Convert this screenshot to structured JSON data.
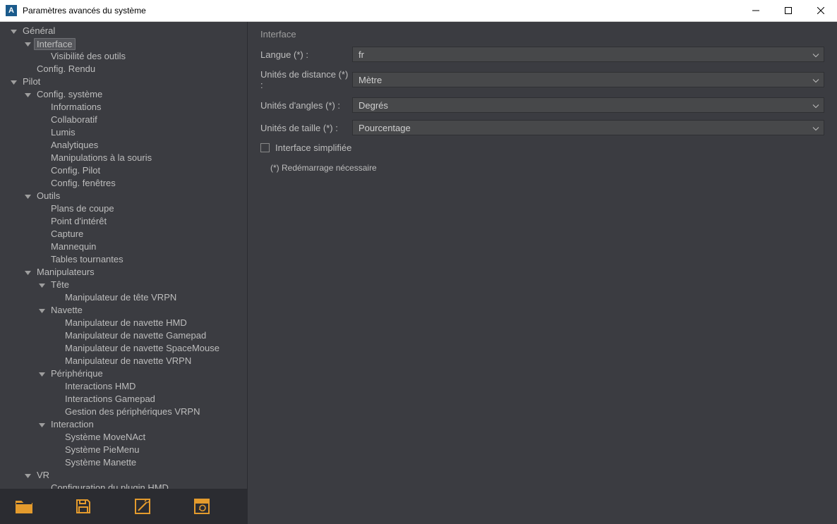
{
  "window": {
    "title": "Paramètres avancés du système",
    "icon_letter": "A"
  },
  "tree": [
    {
      "depth": 0,
      "exp": true,
      "label": "Général"
    },
    {
      "depth": 1,
      "exp": true,
      "label": "Interface",
      "selected": true
    },
    {
      "depth": 2,
      "exp": null,
      "label": "Visibilité des outils"
    },
    {
      "depth": 1,
      "exp": null,
      "label": "Config. Rendu"
    },
    {
      "depth": 0,
      "exp": true,
      "label": "Pilot"
    },
    {
      "depth": 1,
      "exp": true,
      "label": "Config. système"
    },
    {
      "depth": 2,
      "exp": null,
      "label": "Informations"
    },
    {
      "depth": 2,
      "exp": null,
      "label": "Collaboratif"
    },
    {
      "depth": 2,
      "exp": null,
      "label": "Lumis"
    },
    {
      "depth": 2,
      "exp": null,
      "label": "Analytiques"
    },
    {
      "depth": 2,
      "exp": null,
      "label": "Manipulations à la souris"
    },
    {
      "depth": 2,
      "exp": null,
      "label": "Config. Pilot"
    },
    {
      "depth": 2,
      "exp": null,
      "label": "Config. fenêtres"
    },
    {
      "depth": 1,
      "exp": true,
      "label": "Outils"
    },
    {
      "depth": 2,
      "exp": null,
      "label": "Plans de coupe"
    },
    {
      "depth": 2,
      "exp": null,
      "label": "Point d'intérêt"
    },
    {
      "depth": 2,
      "exp": null,
      "label": "Capture"
    },
    {
      "depth": 2,
      "exp": null,
      "label": "Mannequin"
    },
    {
      "depth": 2,
      "exp": null,
      "label": "Tables tournantes"
    },
    {
      "depth": 1,
      "exp": true,
      "label": "Manipulateurs"
    },
    {
      "depth": 2,
      "exp": true,
      "label": "Tête"
    },
    {
      "depth": 3,
      "exp": null,
      "label": "Manipulateur de tête VRPN"
    },
    {
      "depth": 2,
      "exp": true,
      "label": "Navette"
    },
    {
      "depth": 3,
      "exp": null,
      "label": "Manipulateur de navette HMD"
    },
    {
      "depth": 3,
      "exp": null,
      "label": "Manipulateur de navette Gamepad"
    },
    {
      "depth": 3,
      "exp": null,
      "label": "Manipulateur de navette SpaceMouse"
    },
    {
      "depth": 3,
      "exp": null,
      "label": "Manipulateur de navette VRPN"
    },
    {
      "depth": 2,
      "exp": true,
      "label": "Périphérique"
    },
    {
      "depth": 3,
      "exp": null,
      "label": "Interactions HMD"
    },
    {
      "depth": 3,
      "exp": null,
      "label": "Interactions Gamepad"
    },
    {
      "depth": 3,
      "exp": null,
      "label": "Gestion des périphériques VRPN"
    },
    {
      "depth": 2,
      "exp": true,
      "label": "Interaction"
    },
    {
      "depth": 3,
      "exp": null,
      "label": "Système MoveNAct"
    },
    {
      "depth": 3,
      "exp": null,
      "label": "Système PieMenu"
    },
    {
      "depth": 3,
      "exp": null,
      "label": "Système Manette"
    },
    {
      "depth": 1,
      "exp": true,
      "label": "VR"
    },
    {
      "depth": 2,
      "exp": null,
      "label": "Configuration du plugin HMD"
    }
  ],
  "content": {
    "section_title": "Interface",
    "fields": {
      "langue": {
        "label": "Langue (*) :",
        "value": "fr"
      },
      "distance": {
        "label": "Unités de distance (*) :",
        "value": "Mètre"
      },
      "angles": {
        "label": "Unités d'angles (*) :",
        "value": "Degrés"
      },
      "taille": {
        "label": "Unités de taille (*) :",
        "value": "Pourcentage"
      }
    },
    "checkbox_label": "Interface simplifiée",
    "note": "(*) Redémarrage nécessaire"
  }
}
